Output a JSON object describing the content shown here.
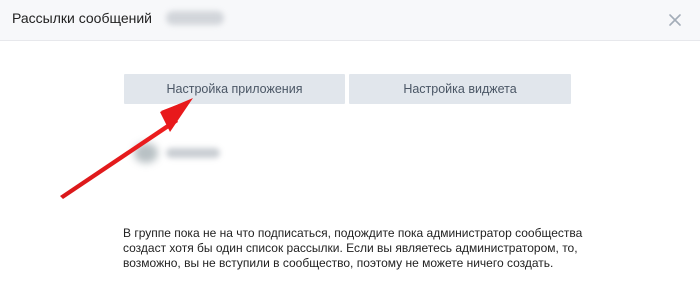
{
  "dialog": {
    "title": "Рассылки сообщений",
    "close_icon": "close-icon"
  },
  "tabs": [
    {
      "label": "Настройка приложения"
    },
    {
      "label": "Настройка виджета"
    }
  ],
  "message": {
    "lines": [
      "В группе пока не на что подписаться, подождите пока администратор сообщества",
      "создаст хотя бы один список рассылки. Если вы являетесь администратором, то,",
      "возможно, вы не вступили в сообщество, поэтому не можете ничего создать."
    ]
  },
  "colors": {
    "header_bg": "#f7f8fa",
    "button_bg": "#e1e6ec",
    "button_text": "#4a5665",
    "arrow": "#e8191b"
  }
}
